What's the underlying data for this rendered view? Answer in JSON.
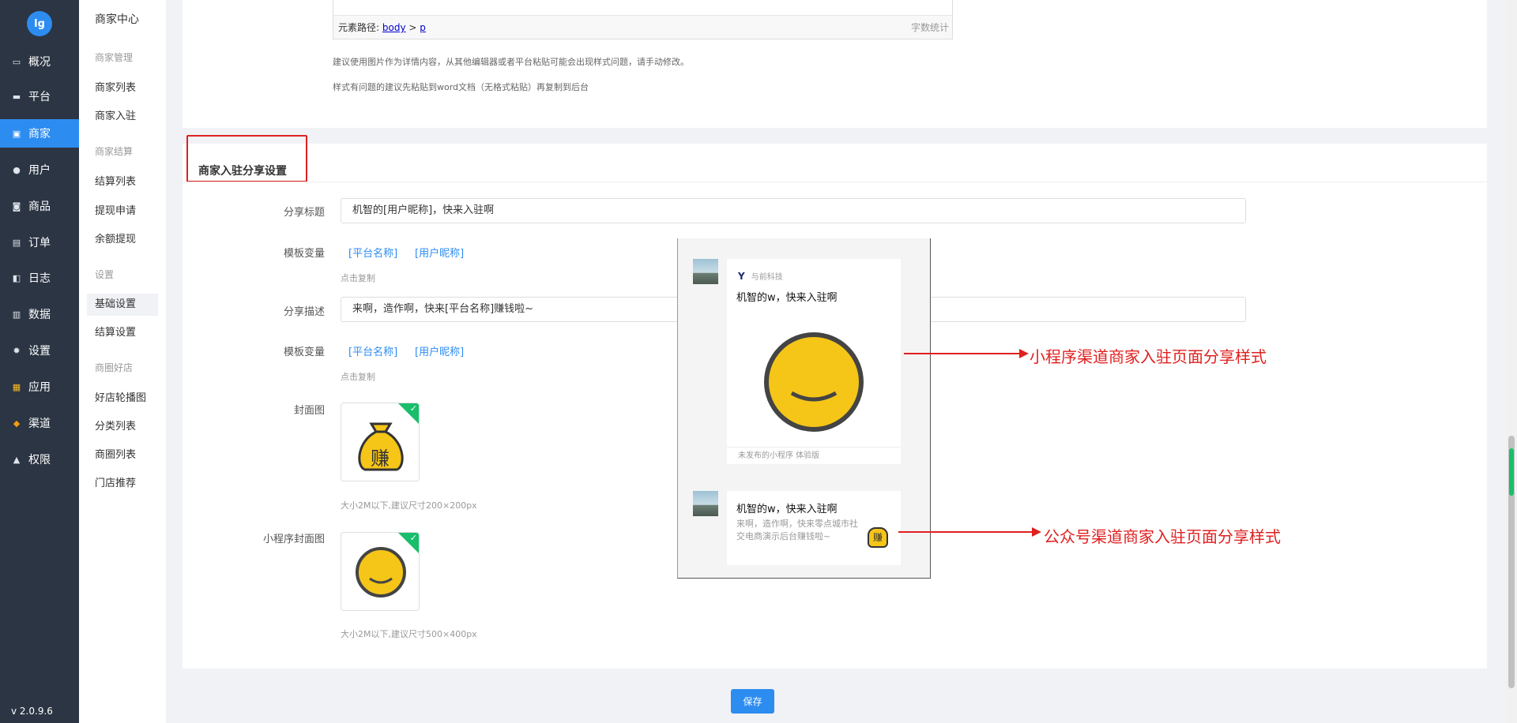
{
  "version": "v 2.0.9.6",
  "logo_text": "lg",
  "nav": [
    {
      "label": "概况",
      "icon": "overview-icon",
      "glyph": "▭"
    },
    {
      "label": "平台",
      "icon": "monitor-icon",
      "glyph": "▬"
    },
    {
      "label": "商家",
      "icon": "store-icon",
      "glyph": "▣"
    },
    {
      "label": "用户",
      "icon": "user-icon",
      "glyph": "●"
    },
    {
      "label": "商品",
      "icon": "product-icon",
      "glyph": "◙"
    },
    {
      "label": "订单",
      "icon": "order-icon",
      "glyph": "▤"
    },
    {
      "label": "日志",
      "icon": "log-icon",
      "glyph": "◧"
    },
    {
      "label": "数据",
      "icon": "chart-icon",
      "glyph": "▥"
    },
    {
      "label": "设置",
      "icon": "gear-icon",
      "glyph": "✹"
    },
    {
      "label": "应用",
      "icon": "apps-icon",
      "glyph": "▦"
    },
    {
      "label": "渠道",
      "icon": "channel-icon",
      "glyph": "◆"
    },
    {
      "label": "权限",
      "icon": "lock-icon",
      "glyph": "▲"
    }
  ],
  "submenu": {
    "title": "商家中心",
    "groups": [
      {
        "head": "商家管理",
        "items": [
          "商家列表",
          "商家入驻"
        ]
      },
      {
        "head": "商家结算",
        "items": [
          "结算列表",
          "提现申请",
          "余额提现"
        ]
      },
      {
        "head": "设置",
        "items": [
          "基础设置",
          "结算设置"
        ]
      },
      {
        "head": "商圈好店",
        "items": [
          "好店轮播图",
          "分类列表",
          "商圈列表",
          "门店推荐"
        ]
      }
    ]
  },
  "editor": {
    "path_label": "元素路径:",
    "path_body": "body",
    "path_sep": ">",
    "path_p": "p",
    "count_label": "字数统计"
  },
  "tips": [
    "建议使用图片作为详情内容，从其他编辑器或者平台粘贴可能会出现样式问题，请手动修改。",
    "样式有问题的建议先粘贴到word文档（无格式粘贴）再复制到后台"
  ],
  "section_title": "商家入驻分享设置",
  "form": {
    "share_title_label": "分享标题",
    "share_title_value": "机智的[用户昵称]，快来入驻啊",
    "template_var_label": "模板变量",
    "var_platform": "[平台名称]",
    "var_nickname": "[用户昵称]",
    "click_copy": "点击复制",
    "share_desc_label": "分享描述",
    "share_desc_value": "来啊，造作啊，快来[平台名称]赚钱啦~",
    "cover_label": "封面图",
    "cover_char": "赚",
    "cover_hint": "大小2M以下,建议尺寸200×200px",
    "mini_cover_label": "小程序封面图",
    "mini_cover_hint": "大小2M以下,建议尺寸500×400px"
  },
  "save_label": "保存",
  "preview": {
    "brand_name": "与前科技",
    "mini_title": "机智的w，快来入驻啊",
    "mini_foot": "未发布的小程序 体验版",
    "mp_title": "机智的w，快来入驻啊",
    "mp_desc": "来啊，造作啊，快来零点城市社交电商演示后台赚钱啦~",
    "mp_thumb_char": "赚"
  },
  "annotations": {
    "mini": "小程序渠道商家入驻页面分享样式",
    "mp": "公众号渠道商家入驻页面分享样式"
  },
  "colors": {
    "primary": "#2d8cf0",
    "nav_bg": "#2b3543",
    "annotation_red": "#e02020",
    "success_green": "#19be6b"
  }
}
